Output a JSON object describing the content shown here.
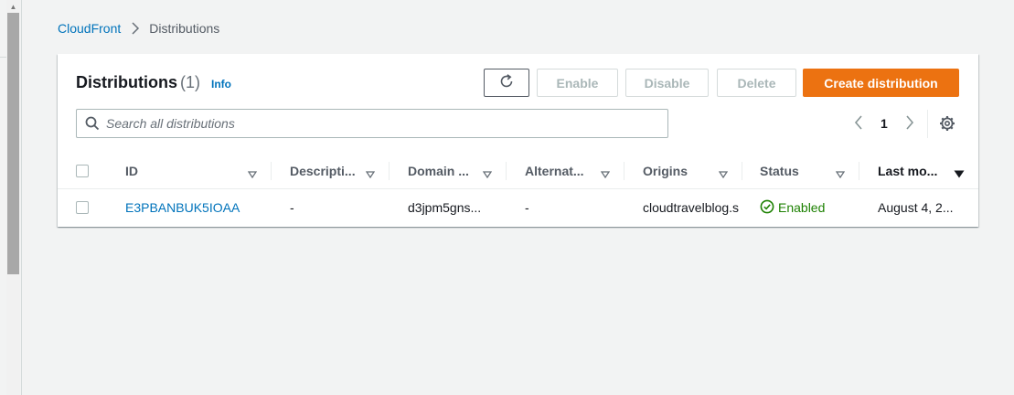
{
  "breadcrumb": {
    "parent": "CloudFront",
    "current": "Distributions"
  },
  "panel": {
    "title": "Distributions",
    "count": "(1)",
    "info": "Info"
  },
  "buttons": {
    "enable": "Enable",
    "disable": "Disable",
    "delete": "Delete",
    "create": "Create distribution"
  },
  "search": {
    "placeholder": "Search all distributions",
    "value": ""
  },
  "pagination": {
    "current_page": "1"
  },
  "table": {
    "headers": [
      "ID",
      "Descripti...",
      "Domain ...",
      "Alternat...",
      "Origins",
      "Status",
      "Last mo..."
    ],
    "rows": [
      {
        "id": "E3PBANBUK5IOAA",
        "description": "-",
        "domain": "d3jpm5gns...",
        "alternate": "-",
        "origins": "cloudtravelblog.s",
        "status": "Enabled",
        "last_modified": "August 4, 2..."
      }
    ]
  },
  "colors": {
    "accent": "#0073bb",
    "primary_button": "#ec7211",
    "status_success": "#1d8102",
    "disabled_text": "#aab7b8"
  },
  "icons": [
    "chevron-right-icon",
    "refresh-icon",
    "search-icon",
    "chevron-left-icon",
    "gear-icon",
    "sort-caret-icon",
    "sort-desc-icon",
    "check-circle-icon"
  ]
}
